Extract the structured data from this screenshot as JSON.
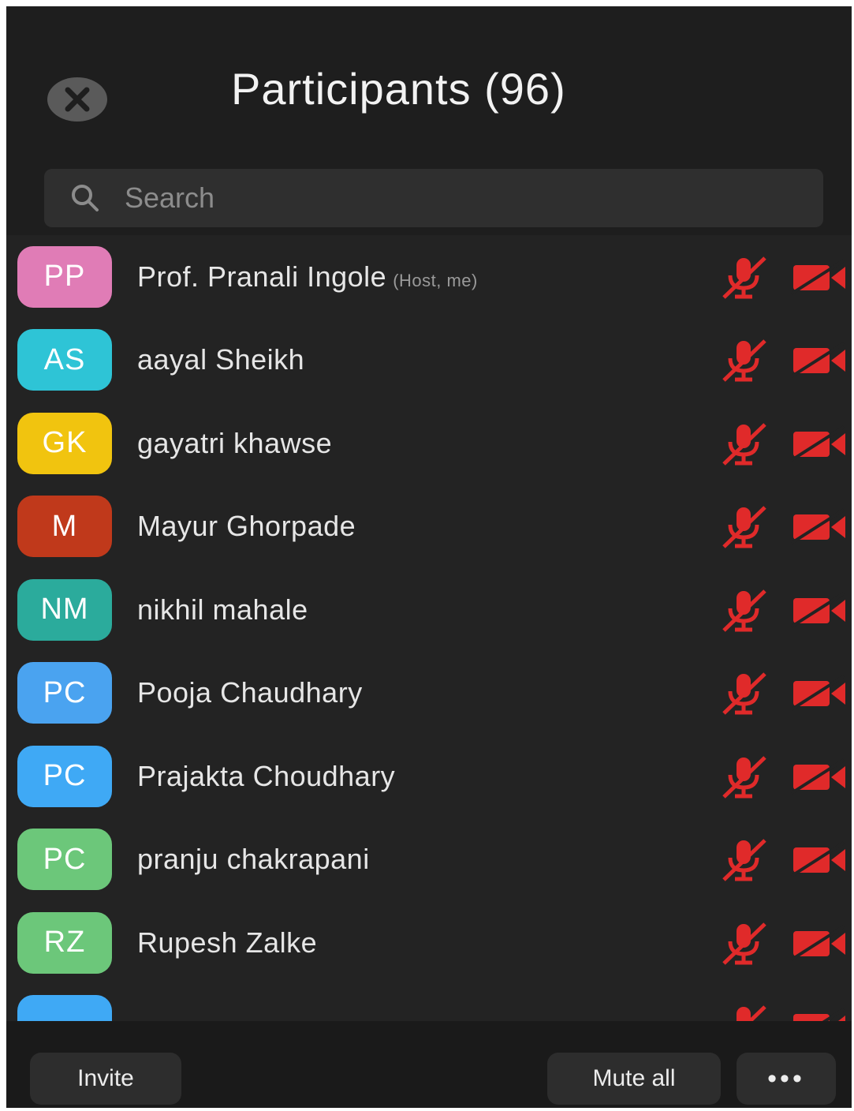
{
  "header": {
    "title": "Participants (96)",
    "close_icon": "close-icon"
  },
  "search": {
    "placeholder": "Search",
    "icon": "search-icon"
  },
  "participants": [
    {
      "initials": "PP",
      "name": "Prof. Pranali Ingole",
      "role": "(Host, me)",
      "color": "#e07cb6",
      "mic": "muted",
      "video": "off"
    },
    {
      "initials": "AS",
      "name": "aayal Sheikh",
      "role": "",
      "color": "#2ec4d6",
      "mic": "muted",
      "video": "off"
    },
    {
      "initials": "GK",
      "name": "gayatri khawse",
      "role": "",
      "color": "#f1c40f",
      "mic": "muted",
      "video": "off"
    },
    {
      "initials": "M",
      "name": "Mayur Ghorpade",
      "role": "",
      "color": "#c0391b",
      "mic": "muted",
      "video": "off"
    },
    {
      "initials": "NM",
      "name": "nikhil mahale",
      "role": "",
      "color": "#2bab9c",
      "mic": "muted",
      "video": "off"
    },
    {
      "initials": "PC",
      "name": "Pooja Chaudhary",
      "role": "",
      "color": "#4aa3f0",
      "mic": "muted",
      "video": "off"
    },
    {
      "initials": "PC",
      "name": "Prajakta Choudhary",
      "role": "",
      "color": "#3fa9f5",
      "mic": "muted",
      "video": "off"
    },
    {
      "initials": "PC",
      "name": "pranju chakrapani",
      "role": "",
      "color": "#6cc77a",
      "mic": "muted",
      "video": "off"
    },
    {
      "initials": "RZ",
      "name": "Rupesh Zalke",
      "role": "",
      "color": "#6cc77a",
      "mic": "muted",
      "video": "off"
    },
    {
      "initials": "",
      "name": "",
      "role": "",
      "color": "#3fa9f5",
      "mic": "muted",
      "video": "off"
    }
  ],
  "footer": {
    "invite_label": "Invite",
    "mute_all_label": "Mute all",
    "more_label": "•••"
  },
  "colors": {
    "background": "#232323",
    "muted_red": "#e02a2a"
  }
}
